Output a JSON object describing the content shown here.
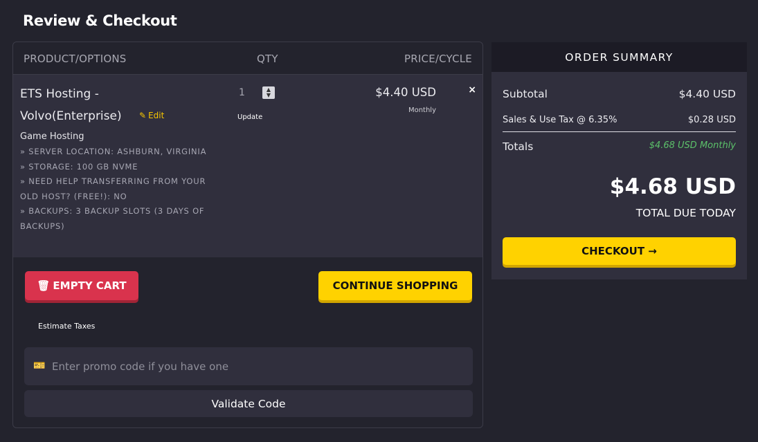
{
  "page": {
    "title": "Review & Checkout"
  },
  "cart": {
    "headers": {
      "product": "PRODUCT/OPTIONS",
      "qty": "QTY",
      "price": "PRICE/CYCLE"
    },
    "item": {
      "name_line1": "ETS Hosting -",
      "name_line2": "Volvo(Enterprise)",
      "edit_label": "Edit",
      "group": "Game Hosting",
      "options": [
        "» Server Location: Ashburn, Virginia",
        "» Storage: 100 GB NVMe",
        "» Need help transferring from your old host? (FREE!): No",
        "» Backups: 3 Backup Slots (3 Days of Backups)"
      ],
      "qty": "1",
      "update_label": "Update",
      "price": "$4.40 USD",
      "cycle": "Monthly",
      "remove": "×"
    },
    "empty_cart_label": "EMPTY CART",
    "continue_label": "CONTINUE SHOPPING",
    "estimate_taxes_label": "Estimate Taxes",
    "promo": {
      "placeholder": "Enter promo code if you have one"
    },
    "validate_label": "Validate Code"
  },
  "summary": {
    "title": "ORDER SUMMARY",
    "subtotal_label": "Subtotal",
    "subtotal_value": "$4.40 USD",
    "tax_label": "Sales & Use Tax @ 6.35%",
    "tax_value": "$0.28 USD",
    "totals_label": "Totals",
    "totals_value": "$4.68 USD Monthly",
    "total_due": "$4.68 USD",
    "total_due_label": "TOTAL DUE TODAY",
    "checkout_label": "CHECKOUT"
  },
  "icons": {
    "edit": "pencil-icon",
    "trash": "trash-icon",
    "ticket": "ticket-icon",
    "arrow": "arrow-right-icon",
    "close": "close-icon"
  },
  "colors": {
    "accent": "#ffd200",
    "danger": "#d9334d",
    "success": "#5cc26a",
    "background": "#23232d",
    "panel": "#302f3d"
  }
}
